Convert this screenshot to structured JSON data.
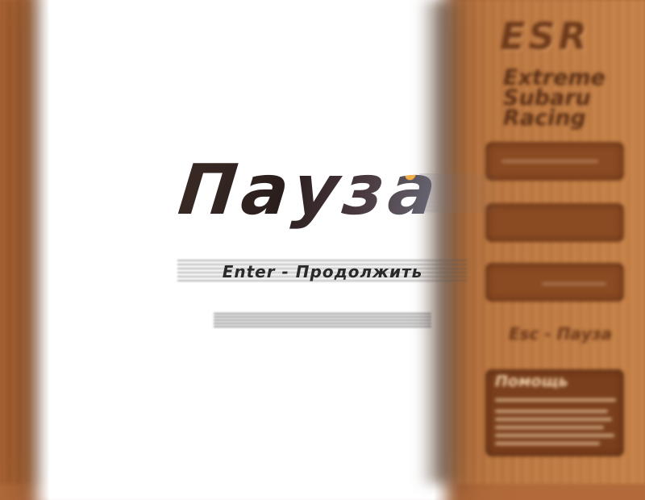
{
  "pause_overlay": {
    "title": "Пауза",
    "resume_hint": "Enter - Продолжить"
  },
  "side_panel": {
    "logo": "ESR",
    "subtitle_lines": [
      "Extreme",
      "Subaru",
      "Racing"
    ],
    "key_hint": "Esc - Пауза",
    "help_title": "Помощь"
  },
  "colors": {
    "wood": "#b26a3a",
    "title_dark": "#2a1e1c",
    "panel_box": "#8a4a22",
    "text_dark": "#2a2a2a"
  }
}
